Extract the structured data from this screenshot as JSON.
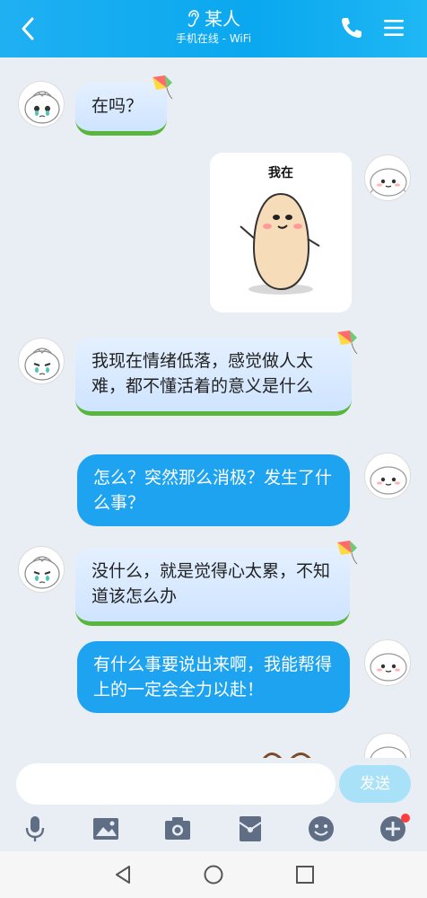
{
  "header": {
    "title": "某人",
    "subtitle": "手机在线 - WiFi",
    "icons": [
      "back-arrow-icon",
      "ear-icon",
      "phone-icon",
      "menu-icon"
    ]
  },
  "messages": [
    {
      "side": "left",
      "type": "text",
      "text": "在吗？"
    },
    {
      "side": "right",
      "type": "sticker",
      "text": "我在"
    },
    {
      "side": "left",
      "type": "text",
      "text": "我现在情绪低落，感觉做人太难，都不懂活着的意义是什么"
    },
    {
      "side": "right",
      "type": "text",
      "text": "怎么？突然那么消极？发生了什么事？"
    },
    {
      "side": "left",
      "type": "text",
      "text": "没什么，就是觉得心太累，不知道该怎么办"
    },
    {
      "side": "right",
      "type": "text",
      "text": "有什么事要说出来啊，我能帮得上的一定会全力以赴！"
    }
  ],
  "composer": {
    "placeholder": "",
    "send_label": "发送",
    "tools": [
      "microphone-icon",
      "image-icon",
      "camera-icon",
      "red-packet-icon",
      "emoji-icon",
      "plus-icon"
    ]
  },
  "navbar": {
    "icons": [
      "back-triangle-icon",
      "home-circle-icon",
      "recents-square-icon"
    ]
  },
  "colors": {
    "header": "#0aa8ef",
    "outgoing_bubble": "#1da3f0",
    "incoming_bubble": "#d7e9ff",
    "incoming_border": "#58b63c",
    "background": "#e9eef5",
    "send_button": "#a9e1f8",
    "badge": "#ff3b3b"
  }
}
